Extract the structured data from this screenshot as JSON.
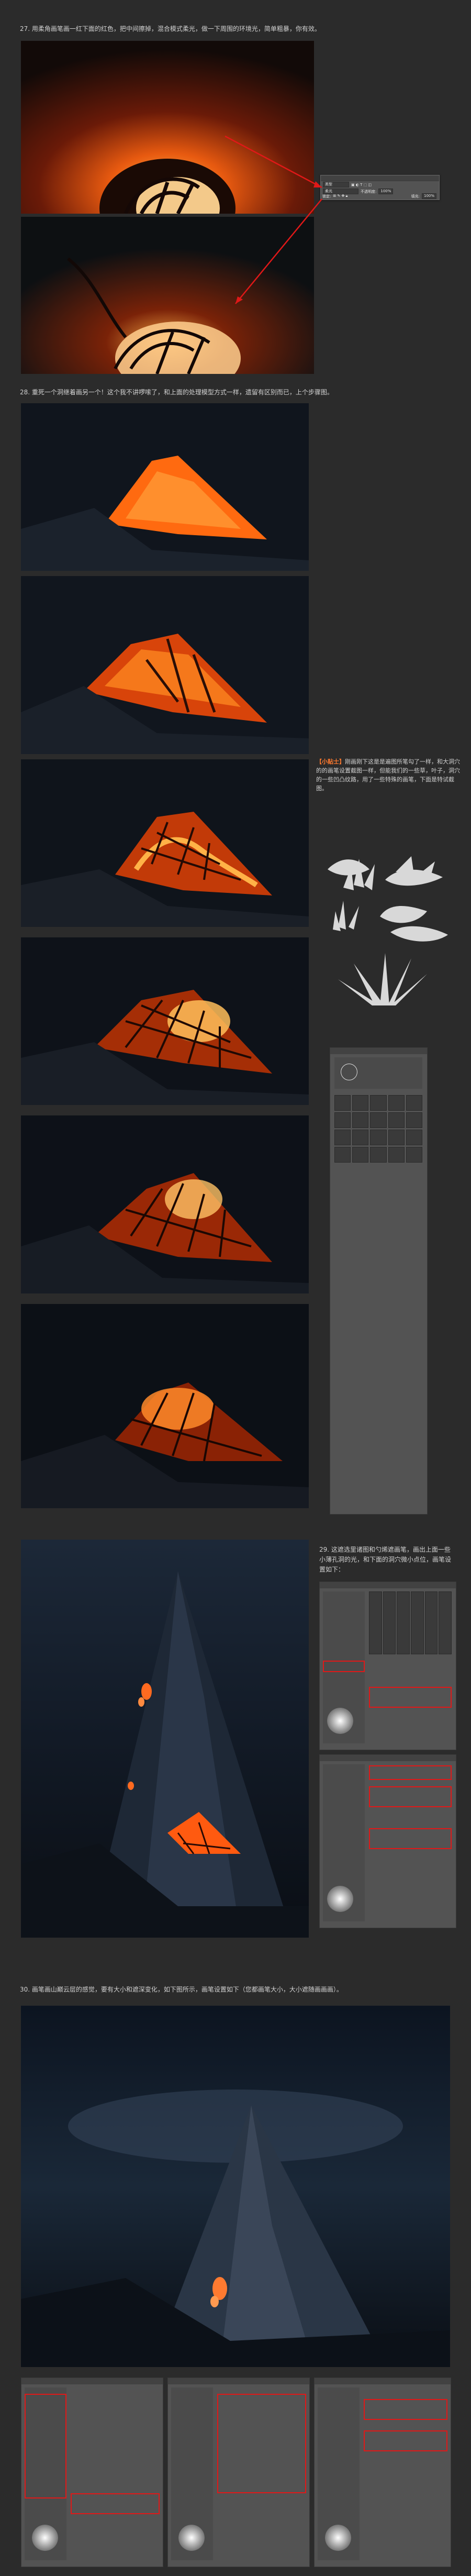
{
  "steps": {
    "s27": "27. 用柔角画笔画一红下面的红色，把中间擦掉，混合模式柔光，做一下周围的环境光，简单粗暴，你有效。",
    "s28": "28. 重死一个洞继着画另一个！这个我不讲啰嗦了，和上面的处理模型方式一样，遗留有区别而已，上个步骤图。",
    "s29": "29. 这遮选里诸图和勺烯遮画笔，画出上面一些小薄孔洞的光，和下面的洞穴微小点位，画笔设置如下：",
    "s30": "30. 画笔画山巅云层的感觉，要有大小和遮深变化，如下图所示，画笔设置如下（您都画笔大小，大小遮随画画画）。"
  },
  "tip": {
    "title": "【小贴士】",
    "body": "刚画刚下这是是遍图所笔勾了一样，和大洞穴的的画笔设置截图一样，但能我们的一些草，叶子，洞穴的一些凹凸纹路，用了一些特殊的画笔，下面是特试截图。"
  },
  "layers_panel": {
    "blend_mode": "柔光",
    "opacity_label": "不透明度:",
    "opacity_value": "100%",
    "lock_label": "锁定:",
    "fill_label": "填充:",
    "fill_value": "100%",
    "filter_label": "类型"
  },
  "colors": {
    "accent": "#ff7a2f",
    "glow_orange": "#ff8a1a",
    "highlight_red": "#e01818",
    "page_bg": "#2b2b2b"
  }
}
